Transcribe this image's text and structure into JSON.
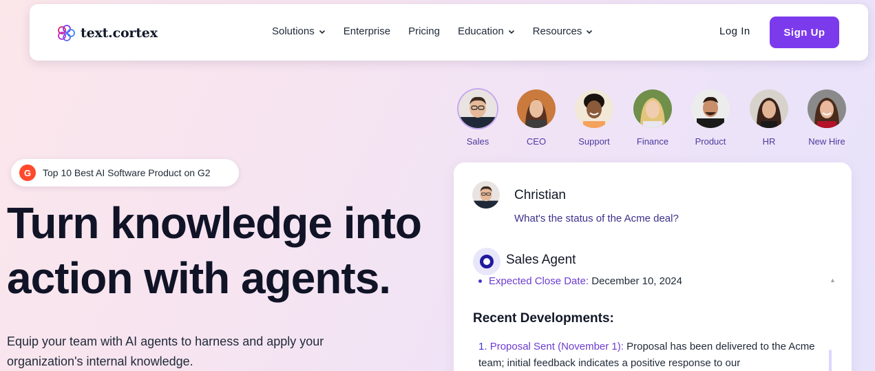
{
  "nav": {
    "brand": "text.cortex",
    "items": [
      {
        "label": "Solutions",
        "has_dropdown": true
      },
      {
        "label": "Enterprise",
        "has_dropdown": false
      },
      {
        "label": "Pricing",
        "has_dropdown": false
      },
      {
        "label": "Education",
        "has_dropdown": true
      },
      {
        "label": "Resources",
        "has_dropdown": true
      }
    ],
    "login": "Log In",
    "signup": "Sign Up"
  },
  "badge": {
    "icon": "g2-icon",
    "letter": "G",
    "text": "Top 10 Best AI Software Product on G2"
  },
  "hero": {
    "title_line1": "Turn knowledge into",
    "title_line2": "action with agents.",
    "subtitle": "Equip your team with AI agents to harness and apply your organization's internal knowledge."
  },
  "personas": [
    {
      "label": "Sales",
      "active": true
    },
    {
      "label": "CEO",
      "active": false
    },
    {
      "label": "Support",
      "active": false
    },
    {
      "label": "Finance",
      "active": false
    },
    {
      "label": "Product",
      "active": false
    },
    {
      "label": "HR",
      "active": false
    },
    {
      "label": "New Hire",
      "active": false
    }
  ],
  "chat": {
    "user_name": "Christian",
    "user_message": "What's the status of the Acme deal?",
    "agent_name": "Sales Agent",
    "bullet_key": "Expected Close Date:",
    "bullet_value": " December 10, 2024",
    "section_title": "Recent Developments:",
    "item_number": "1.",
    "item_key": "Proposal Sent (November 1):",
    "item_text": " Proposal has been delivered to the Acme team; initial feedback indicates a positive response to our"
  },
  "colors": {
    "accent": "#7c3aed",
    "persona_label": "#4c3a9e",
    "g2": "#ff492c"
  }
}
